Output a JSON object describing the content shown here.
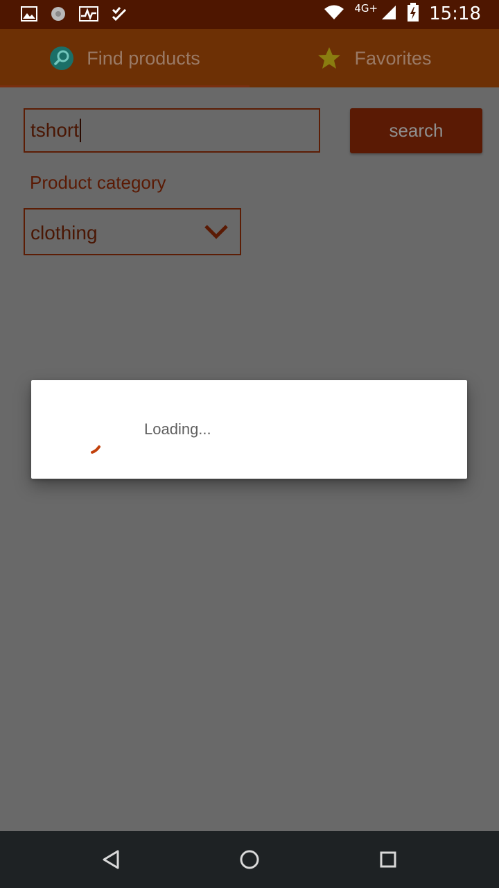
{
  "status_bar": {
    "time": "15:18",
    "network": "4G+",
    "left_icons": [
      "image-icon",
      "aperture-icon",
      "activity-icon",
      "tasks-icon"
    ],
    "right_icons": [
      "wifi-icon",
      "signal-icon",
      "battery-icon"
    ]
  },
  "tabs": [
    {
      "label": "Find products",
      "icon": "search-icon",
      "selected": true
    },
    {
      "label": "Favorites",
      "icon": "star-icon",
      "selected": false
    }
  ],
  "search": {
    "value": "tshort",
    "button_label": "search"
  },
  "category": {
    "label": "Product category",
    "selected": "clothing"
  },
  "dialog": {
    "message": "Loading..."
  },
  "colors": {
    "accent": "#c2410c",
    "primary_dark": "#4e1600",
    "primary": "#6d3005",
    "scrim": "#696969"
  },
  "nav_bar": {
    "icons": [
      "back-icon",
      "home-icon",
      "recents-icon"
    ]
  }
}
